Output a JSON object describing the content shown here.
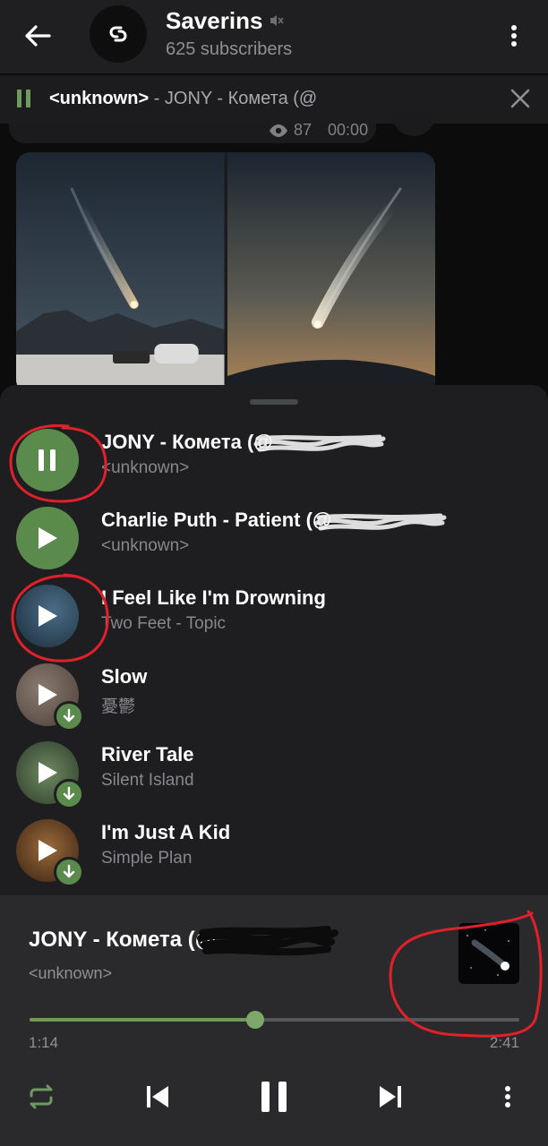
{
  "header": {
    "channel_name": "Saverins",
    "subscribers": "625 subscribers",
    "avatar_icon": "link-logo-icon",
    "muted": true
  },
  "mini_player": {
    "performer": "<unknown>",
    "title_rest": " - JONY - Комета (@",
    "state": "playing"
  },
  "chat": {
    "views": "87",
    "time": "00:00"
  },
  "playlist": [
    {
      "title": "JONY - Комета (@",
      "artist": "<unknown>",
      "state": "playing",
      "thumb": "green-circle",
      "downloaded": true
    },
    {
      "title": "Charlie Puth - Patient (@",
      "artist": "<unknown>",
      "state": "paused",
      "thumb": "green-circle",
      "downloaded": true
    },
    {
      "title": "I Feel Like I'm Drowning",
      "artist": "Two Feet - Topic",
      "state": "paused",
      "thumb": "cover-art",
      "downloaded": true
    },
    {
      "title": "Slow",
      "artist": "憂鬱",
      "state": "paused",
      "thumb": "cover-art",
      "downloaded": false
    },
    {
      "title": "River Tale",
      "artist": "Silent Island",
      "state": "paused",
      "thumb": "cover-art",
      "downloaded": false
    },
    {
      "title": "I'm Just A Kid",
      "artist": "Simple Plan",
      "state": "paused",
      "thumb": "cover-art",
      "downloaded": false
    }
  ],
  "now_playing": {
    "title": "JONY - Комета (@",
    "artist": "<unknown>",
    "current_time": "1:14",
    "total_time": "2:41",
    "progress": 0.46
  },
  "colors": {
    "accent": "#6f9a5e",
    "play_button": "#5b8a4d",
    "annotation_red": "#e0202a"
  }
}
